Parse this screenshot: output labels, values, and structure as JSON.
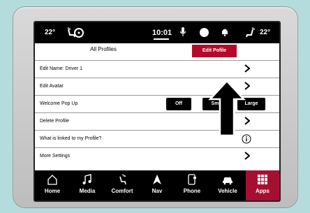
{
  "status": {
    "temp_left": "22°",
    "clock": "10:01",
    "temp_right": "22°"
  },
  "tabs": {
    "all_profiles": "All Profiles",
    "edit_profile": "Edit Pofile"
  },
  "rows": [
    {
      "label": "Edit Name: Driver 1",
      "control": "chevron"
    },
    {
      "label": "Edit Avatar",
      "control": "chevron"
    },
    {
      "label": "Welcome Pop Up",
      "control": "options"
    },
    {
      "label": "Delete Profile",
      "control": "chevron"
    },
    {
      "label": "What is linked to my Profile?",
      "control": "info"
    },
    {
      "label": "More Settings",
      "control": "chevron"
    }
  ],
  "welcome_options": [
    "Off",
    "Sm",
    "Large"
  ],
  "nav": [
    {
      "label": "Home",
      "icon": "home-icon"
    },
    {
      "label": "Media",
      "icon": "music-note-icon"
    },
    {
      "label": "Comfort",
      "icon": "heated-seat-icon"
    },
    {
      "label": "Nav",
      "icon": "navigation-arrow-icon"
    },
    {
      "label": "Phone",
      "icon": "phone-icon"
    },
    {
      "label": "Vehicle",
      "icon": "car-icon"
    },
    {
      "label": "Apps",
      "icon": "apps-grid-icon",
      "active": true
    }
  ],
  "colors": {
    "accent": "#a51032",
    "tab_active": "#b40a2a"
  }
}
